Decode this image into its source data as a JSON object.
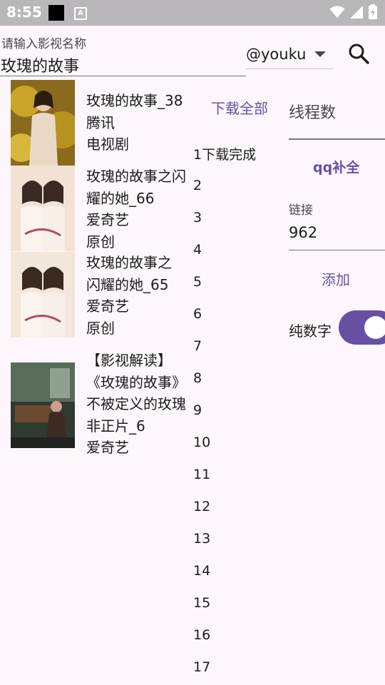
{
  "status_bar": {
    "time": "8:55",
    "icons": [
      "black-square-icon",
      "a-notification-icon",
      "wifi-icon",
      "signal-icon",
      "battery-charging-icon"
    ]
  },
  "search": {
    "hint": "请输入影视名称",
    "value": "玫瑰的故事",
    "source": "@youku",
    "search_icon": "search-icon"
  },
  "results": [
    {
      "lines": [
        "玫瑰的故事_38",
        "腾讯",
        "电视剧"
      ]
    },
    {
      "lines": [
        "玫瑰的故事之闪",
        "耀的她_66",
        "爱奇艺",
        "原创"
      ]
    },
    {
      "lines": [
        "玫瑰的故事之",
        "闪耀的她_65",
        "爱奇艺",
        "原创"
      ]
    },
    {
      "lines": [
        "【影视解读】",
        "《玫瑰的故事》",
        "不被定义的玫瑰",
        "非正片_6",
        "爱奇艺"
      ]
    }
  ],
  "download_all": "下载全部",
  "episodes": [
    "1下载完成",
    "2",
    "3",
    "4",
    "5",
    "6",
    "7",
    "8",
    "9",
    "10",
    "11",
    "12",
    "13",
    "14",
    "15",
    "16",
    "17"
  ],
  "right_panel": {
    "thread_label": "线程数",
    "thread_value": "",
    "qq_button": "qq补全",
    "link_label": "链接",
    "link_value": "962",
    "add_button": "添加",
    "numeric_label": "纯数字",
    "numeric_toggle_on": true
  },
  "colors": {
    "accent": "#6750a4",
    "background": "#fdf7fd",
    "status_bar": "#b9b6bc"
  }
}
